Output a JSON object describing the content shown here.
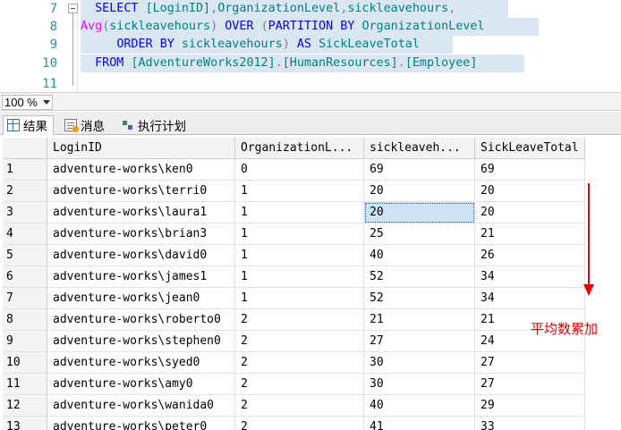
{
  "editor": {
    "lines": [
      {
        "num": "7",
        "tokens": [
          {
            "t": "  ",
            "c": ""
          },
          {
            "t": "SELECT",
            "c": "kw"
          },
          {
            "t": " ",
            "c": ""
          },
          {
            "t": "[LoginID]",
            "c": "id"
          },
          {
            "t": ",",
            "c": "gr"
          },
          {
            "t": "OrganizationLevel",
            "c": "id"
          },
          {
            "t": ",",
            "c": "gr"
          },
          {
            "t": "sickleavehours",
            "c": "id"
          },
          {
            "t": ",",
            "c": "gr"
          }
        ]
      },
      {
        "num": "8",
        "tokens": [
          {
            "t": "Avg",
            "c": "fn"
          },
          {
            "t": "(",
            "c": "gr"
          },
          {
            "t": "sickleavehours",
            "c": "id"
          },
          {
            "t": ")",
            "c": "gr"
          },
          {
            "t": " ",
            "c": ""
          },
          {
            "t": "OVER",
            "c": "kw"
          },
          {
            "t": " ",
            "c": ""
          },
          {
            "t": "(",
            "c": "gr"
          },
          {
            "t": "PARTITION",
            "c": "kw"
          },
          {
            "t": " ",
            "c": ""
          },
          {
            "t": "BY",
            "c": "kw"
          },
          {
            "t": " ",
            "c": ""
          },
          {
            "t": "OrganizationLevel",
            "c": "id"
          }
        ]
      },
      {
        "num": "9",
        "tokens": [
          {
            "t": "     ",
            "c": ""
          },
          {
            "t": "ORDER",
            "c": "kw"
          },
          {
            "t": " ",
            "c": ""
          },
          {
            "t": "BY",
            "c": "kw"
          },
          {
            "t": " ",
            "c": ""
          },
          {
            "t": "sickleavehours",
            "c": "id"
          },
          {
            "t": ")",
            "c": "gr"
          },
          {
            "t": " ",
            "c": ""
          },
          {
            "t": "AS",
            "c": "kw"
          },
          {
            "t": " ",
            "c": ""
          },
          {
            "t": "SickLeaveTotal",
            "c": "id"
          }
        ]
      },
      {
        "num": "10",
        "tokens": [
          {
            "t": "  ",
            "c": ""
          },
          {
            "t": "FROM",
            "c": "kw"
          },
          {
            "t": " ",
            "c": ""
          },
          {
            "t": "[AdventureWorks2012]",
            "c": "id"
          },
          {
            "t": ".",
            "c": "gr"
          },
          {
            "t": "[HumanResources]",
            "c": "id"
          },
          {
            "t": ".",
            "c": "gr"
          },
          {
            "t": "[Employee]",
            "c": "id"
          }
        ]
      },
      {
        "num": "11",
        "tokens": []
      }
    ]
  },
  "zoom": {
    "value": "100 %"
  },
  "tabs": [
    {
      "label": "结果",
      "icon": "results-grid-icon",
      "active": true
    },
    {
      "label": "消息",
      "icon": "messages-icon",
      "active": false
    },
    {
      "label": "执行计划",
      "icon": "execution-plan-icon",
      "active": false
    }
  ],
  "grid": {
    "columns": [
      "LoginID",
      "OrganizationL...",
      "sickleaveh...",
      "SickLeaveTotal"
    ],
    "rows": [
      [
        "1",
        "adventure-works\\ken0",
        "0",
        "69",
        "69"
      ],
      [
        "2",
        "adventure-works\\terri0",
        "1",
        "20",
        "20"
      ],
      [
        "3",
        "adventure-works\\laura1",
        "1",
        "20",
        "20"
      ],
      [
        "4",
        "adventure-works\\brian3",
        "1",
        "25",
        "21"
      ],
      [
        "5",
        "adventure-works\\david0",
        "1",
        "40",
        "26"
      ],
      [
        "6",
        "adventure-works\\james1",
        "1",
        "52",
        "34"
      ],
      [
        "7",
        "adventure-works\\jean0",
        "1",
        "52",
        "34"
      ],
      [
        "8",
        "adventure-works\\roberto0",
        "2",
        "21",
        "21"
      ],
      [
        "9",
        "adventure-works\\stephen0",
        "2",
        "27",
        "24"
      ],
      [
        "10",
        "adventure-works\\syed0",
        "2",
        "30",
        "27"
      ],
      [
        "11",
        "adventure-works\\amy0",
        "2",
        "30",
        "27"
      ],
      [
        "12",
        "adventure-works\\wanida0",
        "2",
        "40",
        "29"
      ],
      [
        "13",
        "adventure-works\\peter0",
        "2",
        "41",
        "33"
      ]
    ],
    "selected_cell": {
      "row": 2,
      "col": 3
    }
  },
  "annotation": {
    "text": "平均数累加",
    "color": "#ee0000"
  }
}
